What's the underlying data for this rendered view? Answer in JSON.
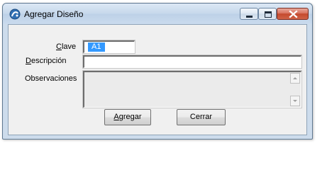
{
  "window": {
    "title": "Agregar Diseño",
    "controls": {
      "minimize": "minimize",
      "maximize": "maximize",
      "close": "close"
    }
  },
  "form": {
    "clave": {
      "label_mnemonic": "C",
      "label_rest": "lave",
      "value": "A1"
    },
    "descripcion": {
      "label_mnemonic": "D",
      "label_rest": "escripción",
      "value": ""
    },
    "observaciones": {
      "label": "Observaciones",
      "value": ""
    }
  },
  "buttons": {
    "agregar": {
      "mnemonic": "A",
      "rest": "gregar"
    },
    "cerrar": {
      "label": "Cerrar"
    }
  },
  "icons": [
    "app-icon",
    "minimize-icon",
    "maximize-icon",
    "close-icon",
    "scroll-up-arrow-icon",
    "scroll-down-arrow-icon"
  ],
  "colors": {
    "selection": "#3399ff",
    "close_button": "#c44a2e",
    "frame": "#cddcec"
  }
}
